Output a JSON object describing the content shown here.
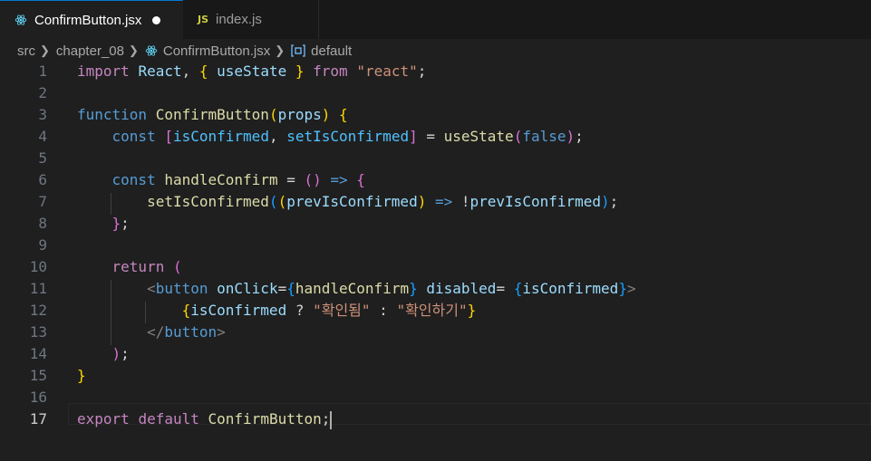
{
  "tabs": [
    {
      "label": "ConfirmButton.jsx",
      "icon": "react-icon",
      "active": true,
      "dirty": true
    },
    {
      "label": "index.js",
      "icon": "JS",
      "active": false
    }
  ],
  "breadcrumb": {
    "items": [
      "src",
      "chapter_08",
      "ConfirmButton.jsx",
      "default"
    ]
  },
  "editor": {
    "current_line": 17,
    "line_numbers": [
      "1",
      "2",
      "3",
      "4",
      "5",
      "6",
      "7",
      "8",
      "9",
      "10",
      "11",
      "12",
      "13",
      "14",
      "15",
      "16",
      "17"
    ],
    "lines": [
      [
        [
          "import",
          "kw"
        ],
        [
          " ",
          ""
        ],
        [
          "React",
          "var"
        ],
        [
          ", ",
          ""
        ],
        [
          "{",
          "p1"
        ],
        [
          " ",
          ""
        ],
        [
          "useState",
          "var"
        ],
        [
          " ",
          ""
        ],
        [
          "}",
          "p1"
        ],
        [
          " ",
          ""
        ],
        [
          "from",
          "kw"
        ],
        [
          " ",
          ""
        ],
        [
          "\"react\"",
          "str"
        ],
        [
          ";",
          ""
        ]
      ],
      [],
      [
        [
          "function",
          "kb"
        ],
        [
          " ",
          ""
        ],
        [
          "ConfirmButton",
          "fn"
        ],
        [
          "(",
          "p1"
        ],
        [
          "props",
          "var"
        ],
        [
          ")",
          "p1"
        ],
        [
          " ",
          ""
        ],
        [
          "{",
          "p1"
        ]
      ],
      [
        [
          "    ",
          ""
        ],
        [
          "const",
          "kb"
        ],
        [
          " ",
          ""
        ],
        [
          "[",
          "p2"
        ],
        [
          "isConfirmed",
          "const"
        ],
        [
          ", ",
          ""
        ],
        [
          "setIsConfirmed",
          "const"
        ],
        [
          "]",
          "p2"
        ],
        [
          " = ",
          ""
        ],
        [
          "useState",
          "fn"
        ],
        [
          "(",
          "p2"
        ],
        [
          "false",
          "kb"
        ],
        [
          ")",
          "p2"
        ],
        [
          ";",
          ""
        ]
      ],
      [],
      [
        [
          "    ",
          ""
        ],
        [
          "const",
          "kb"
        ],
        [
          " ",
          ""
        ],
        [
          "handleConfirm",
          "fn"
        ],
        [
          " = ",
          ""
        ],
        [
          "()",
          "p2"
        ],
        [
          " ",
          ""
        ],
        [
          "=>",
          "kb"
        ],
        [
          " ",
          ""
        ],
        [
          "{",
          "p2"
        ]
      ],
      [
        [
          "        ",
          ""
        ],
        [
          "setIsConfirmed",
          "fn"
        ],
        [
          "(",
          "p3"
        ],
        [
          "(",
          "p1"
        ],
        [
          "prevIsConfirmed",
          "var"
        ],
        [
          ")",
          "p1"
        ],
        [
          " ",
          ""
        ],
        [
          "=>",
          "kb"
        ],
        [
          " !",
          ""
        ],
        [
          "prevIsConfirmed",
          "var"
        ],
        [
          ")",
          "p3"
        ],
        [
          ";",
          ""
        ]
      ],
      [
        [
          "    ",
          ""
        ],
        [
          "}",
          "p2"
        ],
        [
          ";",
          ""
        ]
      ],
      [],
      [
        [
          "    ",
          ""
        ],
        [
          "return",
          "kw"
        ],
        [
          " ",
          ""
        ],
        [
          "(",
          "p2"
        ]
      ],
      [
        [
          "        ",
          ""
        ],
        [
          "<",
          "tag"
        ],
        [
          "button",
          "kb"
        ],
        [
          " ",
          ""
        ],
        [
          "onClick",
          "var"
        ],
        [
          "=",
          ""
        ],
        [
          "{",
          "p3"
        ],
        [
          "handleConfirm",
          "fn"
        ],
        [
          "}",
          "p3"
        ],
        [
          " ",
          ""
        ],
        [
          "disabled",
          "var"
        ],
        [
          "= ",
          ""
        ],
        [
          "{",
          "p3"
        ],
        [
          "isConfirmed",
          "var"
        ],
        [
          "}",
          "p3"
        ],
        [
          ">",
          "tag"
        ]
      ],
      [
        [
          "            ",
          ""
        ],
        [
          "{",
          "p1"
        ],
        [
          "isConfirmed",
          "var"
        ],
        [
          " ? ",
          ""
        ],
        [
          "\"확인됨\"",
          "str"
        ],
        [
          " : ",
          ""
        ],
        [
          "\"확인하기\"",
          "str"
        ],
        [
          "}",
          "p1"
        ]
      ],
      [
        [
          "        ",
          ""
        ],
        [
          "</",
          "tag"
        ],
        [
          "button",
          "kb"
        ],
        [
          ">",
          "tag"
        ]
      ],
      [
        [
          "    ",
          ""
        ],
        [
          ")",
          "p2"
        ],
        [
          ";",
          ""
        ]
      ],
      [
        [
          "}",
          "p1"
        ]
      ],
      [],
      [
        [
          "export",
          "kw"
        ],
        [
          " ",
          ""
        ],
        [
          "default",
          "kw"
        ],
        [
          " ",
          ""
        ],
        [
          "ConfirmButton",
          "fn"
        ],
        [
          ";",
          ""
        ]
      ]
    ]
  }
}
